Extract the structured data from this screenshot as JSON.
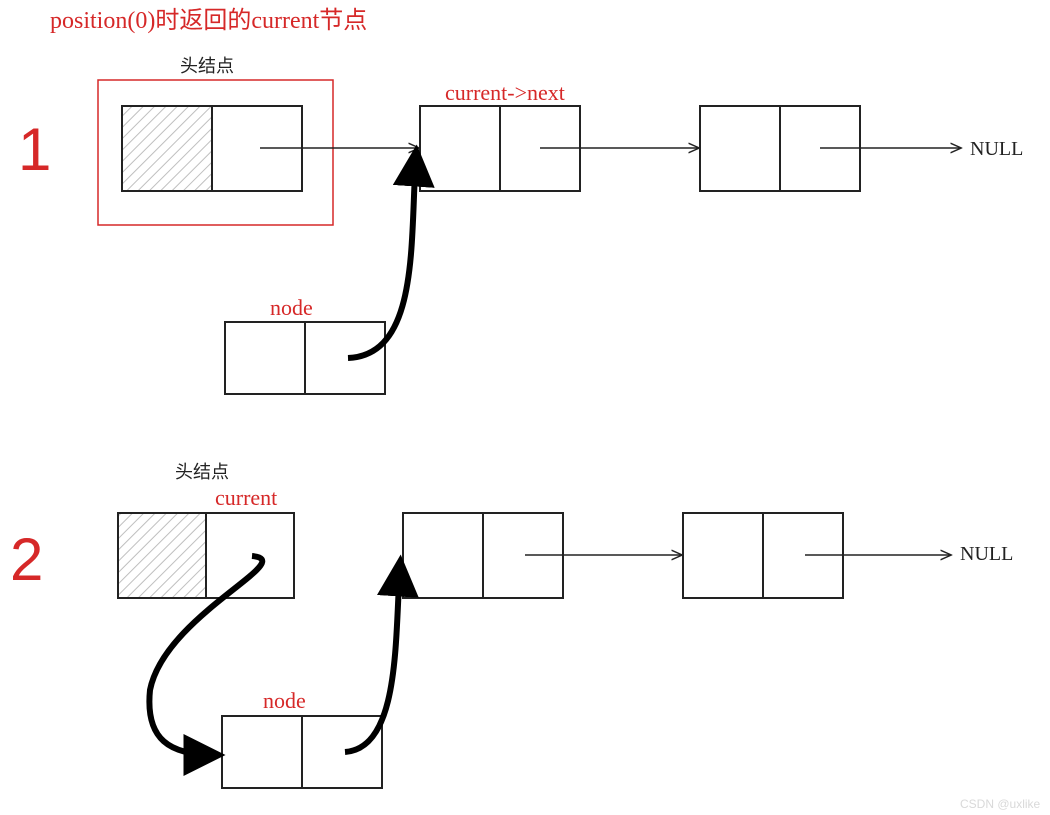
{
  "title": "position(0)时返回的current节点",
  "watermark": "CSDN @uxlike",
  "null_label": "NULL",
  "head_label": "头结点",
  "node_label": "node",
  "current_label": "current",
  "current_next_label": "current->next",
  "step1": "1",
  "step2": "2",
  "colors": {
    "red": "#d62828",
    "black": "#222222",
    "grey_text": "#cccccc",
    "hatch": "#bfbfbf"
  }
}
